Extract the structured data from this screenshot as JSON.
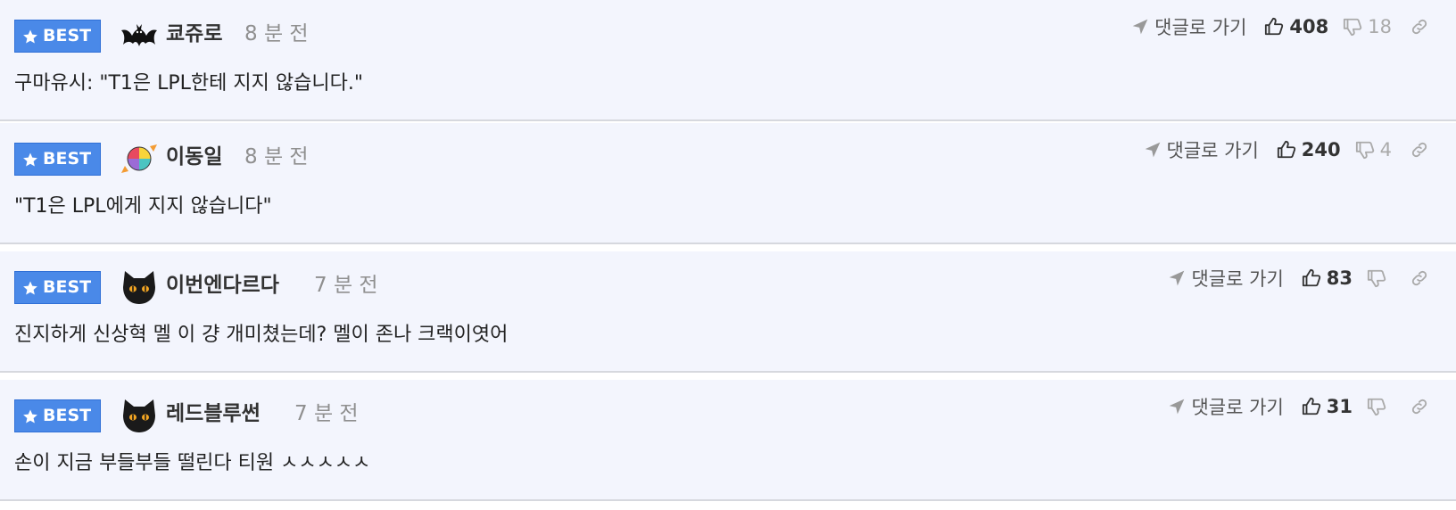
{
  "labels": {
    "best": "BEST",
    "reply": "댓글로 가기"
  },
  "colors": {
    "best_bg": "#4a89e8",
    "comment_bg": "#f3f5fd"
  },
  "comments": [
    {
      "avatar": "bat-icon",
      "nickname": "쿄쥬로",
      "time": "8 분 전",
      "text": "구마유시: \"T1은 LPL한테 지지 않습니다.\"",
      "likes": "408",
      "dislikes": "18"
    },
    {
      "avatar": "candy-icon",
      "nickname": "이동일",
      "time": "8 분 전",
      "text": "\"T1은 LPL에게 지지 않습니다\"",
      "likes": "240",
      "dislikes": "4"
    },
    {
      "avatar": "black-cat-icon",
      "nickname": "이번엔다르다",
      "time": "7 분 전",
      "text": "진지하게 신상혁 멜 이 걍 개미쳤는데? 멜이 존나 크랙이엿어",
      "likes": "83",
      "dislikes": ""
    },
    {
      "avatar": "black-cat-icon",
      "nickname": "레드블루썬",
      "time": "7 분 전",
      "text": "손이 지금 부들부들 떨린다 티원 ㅅㅅㅅㅅㅅ",
      "likes": "31",
      "dislikes": ""
    }
  ]
}
